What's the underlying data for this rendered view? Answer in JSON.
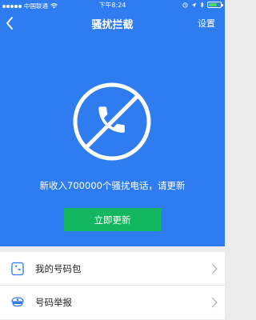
{
  "status_bar": {
    "carrier": "中国联通",
    "time": "下午8:24",
    "battery_level": 0.7
  },
  "nav": {
    "title": "骚扰拦截",
    "settings_label": "设置",
    "back_icon": "chevron-left-icon"
  },
  "main": {
    "emblem_icon": "blocked-phone-icon",
    "message": "新收入700000个骚扰电话，请更新",
    "update_button_label": "立即更新"
  },
  "menu": {
    "items": [
      {
        "label": "我的号码包",
        "icon": "phone-book-icon"
      },
      {
        "label": "号码举报",
        "icon": "police-cap-icon"
      }
    ]
  },
  "colors": {
    "primary_blue": "#2f7cf0",
    "update_green": "#14b75f",
    "battery_green": "#4cd964"
  }
}
